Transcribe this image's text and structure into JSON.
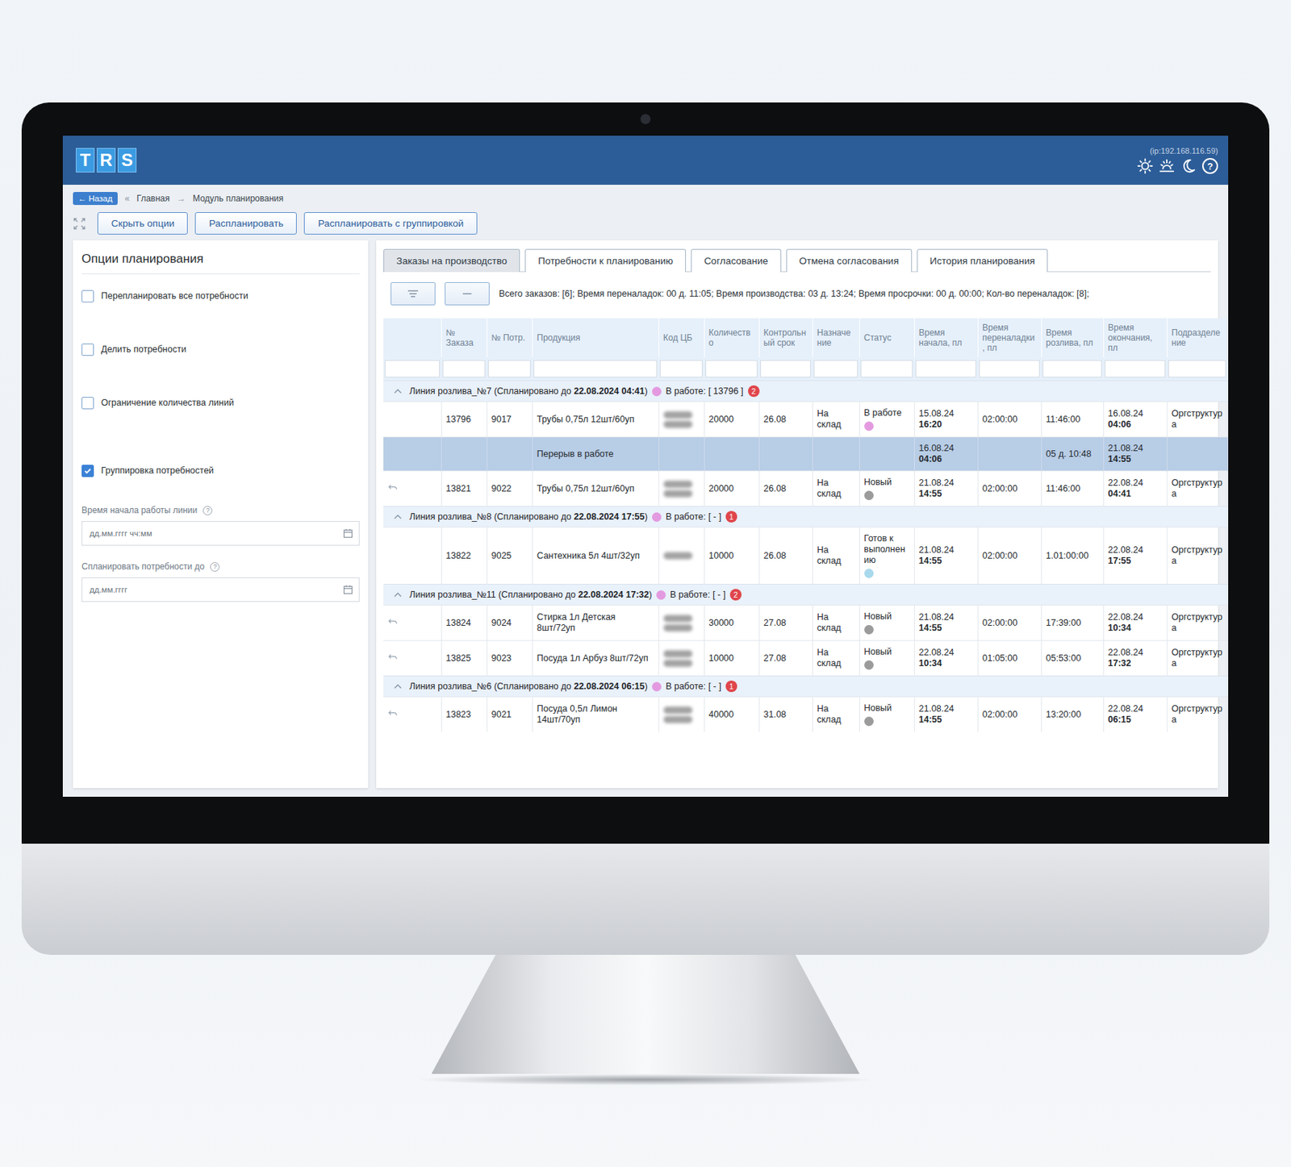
{
  "screen": {
    "ip": "(ip:192.168.116.59)",
    "logo": [
      "T",
      "R",
      "S"
    ],
    "help_icon": "?"
  },
  "breadcrumb": {
    "back_arrow": "←",
    "back": "Назад",
    "separator": "«",
    "items": [
      "Главная",
      "Модуль планирования"
    ],
    "arrow": "→"
  },
  "actions": [
    "Скрыть опции",
    "Распланировать",
    "Распланировать с группировкой"
  ],
  "options": {
    "title": "Опции планирования",
    "checkboxes": [
      {
        "label": "Перепланировать все потребности",
        "checked": false
      },
      {
        "label": "Делить потребности",
        "checked": false
      },
      {
        "label": "Ограничение количества линий",
        "checked": false
      },
      {
        "label": "Группировка потребностей",
        "checked": true
      }
    ],
    "fields": [
      {
        "label": "Время начала работы линии",
        "help": "?",
        "placeholder": "дд.мм.гггг чч:мм"
      },
      {
        "label": "Спланировать потребности до",
        "help": "?",
        "placeholder": "дд.мм.гггг"
      }
    ]
  },
  "tabs": [
    {
      "label": "Заказы на производство",
      "selected": true
    },
    {
      "label": "Потребности к планированию",
      "selected": false
    },
    {
      "label": "Согласование",
      "selected": false
    },
    {
      "label": "Отмена согласования",
      "selected": false
    },
    {
      "label": "История планирования",
      "selected": false
    }
  ],
  "summary": "Всего заказов: [6]; Время переналадок: 00 д. 11:05; Время производства: 03 д. 13:24; Время просрочки: 00 д. 00:00; Кол-во переналадок: [8];",
  "table": {
    "columns": [
      "",
      "№ Заказа",
      "№ Потр.",
      "Продукция",
      "Код ЦБ",
      "Количество",
      "Контрольный срок",
      "Назначение",
      "Статус",
      "Время начала, пл",
      "Время переналадки, пл",
      "Время розлива, пл",
      "Время окончания, пл",
      "Подразделение"
    ],
    "groups": [
      {
        "title": "Линия розлива_№7 (Спланировано до",
        "date": "22.08.2024 04:41",
        "close": ")",
        "color": "#e39ae0",
        "in_work": "В работе: [ 13796 ]",
        "badge": "2",
        "expanded": true,
        "rows": [
          {
            "kind": "order",
            "revertible": false,
            "order": "13796",
            "need": "9017",
            "product": "Трубы 0,75л 12шт/60уп",
            "code_blurred_lines": 2,
            "qty": "20000",
            "deadline": "26.08",
            "purpose": "На склад",
            "status": "В работе",
            "color": "#e39ae0",
            "start": {
              "date": "15.08.24",
              "time": "16:20"
            },
            "changeover": "02:00:00",
            "fill": "11:46:00",
            "end": {
              "date": "16.08.24",
              "time": "04:06"
            },
            "dept": "Оргструктура"
          },
          {
            "kind": "break",
            "label": "Перерыв в работе",
            "start": {
              "date": "16.08.24",
              "time": "04:06"
            },
            "fill": "05 д. 10:48",
            "end": {
              "date": "21.08.24",
              "time": "14:55"
            }
          },
          {
            "kind": "order",
            "revertible": true,
            "order": "13821",
            "need": "9022",
            "product": "Трубы 0,75л 12шт/60уп",
            "code_blurred_lines": 2,
            "qty": "20000",
            "deadline": "26.08",
            "purpose": "На склад",
            "status": "Новый",
            "color": "#9b9b9b",
            "start": {
              "date": "21.08.24",
              "time": "14:55"
            },
            "changeover": "02:00:00",
            "fill": "11:46:00",
            "end": {
              "date": "22.08.24",
              "time": "04:41"
            },
            "dept": "Оргструктура"
          }
        ]
      },
      {
        "title": "Линия розлива_№8 (Спланировано до",
        "date": "22.08.2024 17:55",
        "close": ")",
        "color": "#e39ae0",
        "in_work": "В работе: [ - ]",
        "badge": "1",
        "expanded": true,
        "rows": [
          {
            "kind": "order",
            "revertible": false,
            "order": "13822",
            "need": "9025",
            "product": "Сантехника 5л 4шт/32уп",
            "code_blurred_lines": 1,
            "qty": "10000",
            "deadline": "26.08",
            "purpose": "На склад",
            "status": "Готов к выполнению",
            "color": "#a9d9ec",
            "start": {
              "date": "21.08.24",
              "time": "14:55"
            },
            "changeover": "02:00:00",
            "fill": "1.01:00:00",
            "end": {
              "date": "22.08.24",
              "time": "17:55"
            },
            "dept": "Оргструктура"
          }
        ]
      },
      {
        "title": "Линия розлива_№11 (Спланировано до",
        "date": "22.08.2024 17:32",
        "close": ")",
        "color": "#e39ae0",
        "in_work": "В работе: [ - ]",
        "badge": "2",
        "expanded": true,
        "rows": [
          {
            "kind": "order",
            "revertible": true,
            "order": "13824",
            "need": "9024",
            "product": "Стирка 1л Детская 8шт/72уп",
            "code_blurred_lines": 2,
            "qty": "30000",
            "deadline": "27.08",
            "purpose": "На склад",
            "status": "Новый",
            "color": "#9b9b9b",
            "start": {
              "date": "21.08.24",
              "time": "14:55"
            },
            "changeover": "02:00:00",
            "fill": "17:39:00",
            "end": {
              "date": "22.08.24",
              "time": "10:34"
            },
            "dept": "Оргструктура"
          },
          {
            "kind": "order",
            "revertible": true,
            "order": "13825",
            "need": "9023",
            "product": "Посуда 1л Арбуз 8шт/72уп",
            "code_blurred_lines": 2,
            "qty": "10000",
            "deadline": "27.08",
            "purpose": "На склад",
            "status": "Новый",
            "color": "#9b9b9b",
            "start": {
              "date": "22.08.24",
              "time": "10:34"
            },
            "changeover": "01:05:00",
            "fill": "05:53:00",
            "end": {
              "date": "22.08.24",
              "time": "17:32"
            },
            "dept": "Оргструктура"
          }
        ]
      },
      {
        "title": "Линия розлива_№6 (Спланировано до",
        "date": "22.08.2024 06:15",
        "close": ")",
        "color": "#e39ae0",
        "in_work": "В работе: [ - ]",
        "badge": "1",
        "expanded": true,
        "rows": [
          {
            "kind": "order",
            "revertible": true,
            "order": "13823",
            "need": "9021",
            "product": "Посуда 0,5л Лимон 14шт/70уп",
            "code_blurred_lines": 2,
            "qty": "40000",
            "deadline": "31.08",
            "purpose": "На склад",
            "status": "Новый",
            "color": "#9b9b9b",
            "start": {
              "date": "21.08.24",
              "time": "14:55"
            },
            "changeover": "02:00:00",
            "fill": "13:20:00",
            "end": {
              "date": "22.08.24",
              "time": "06:15"
            },
            "dept": "Оргструктура"
          }
        ]
      }
    ]
  }
}
